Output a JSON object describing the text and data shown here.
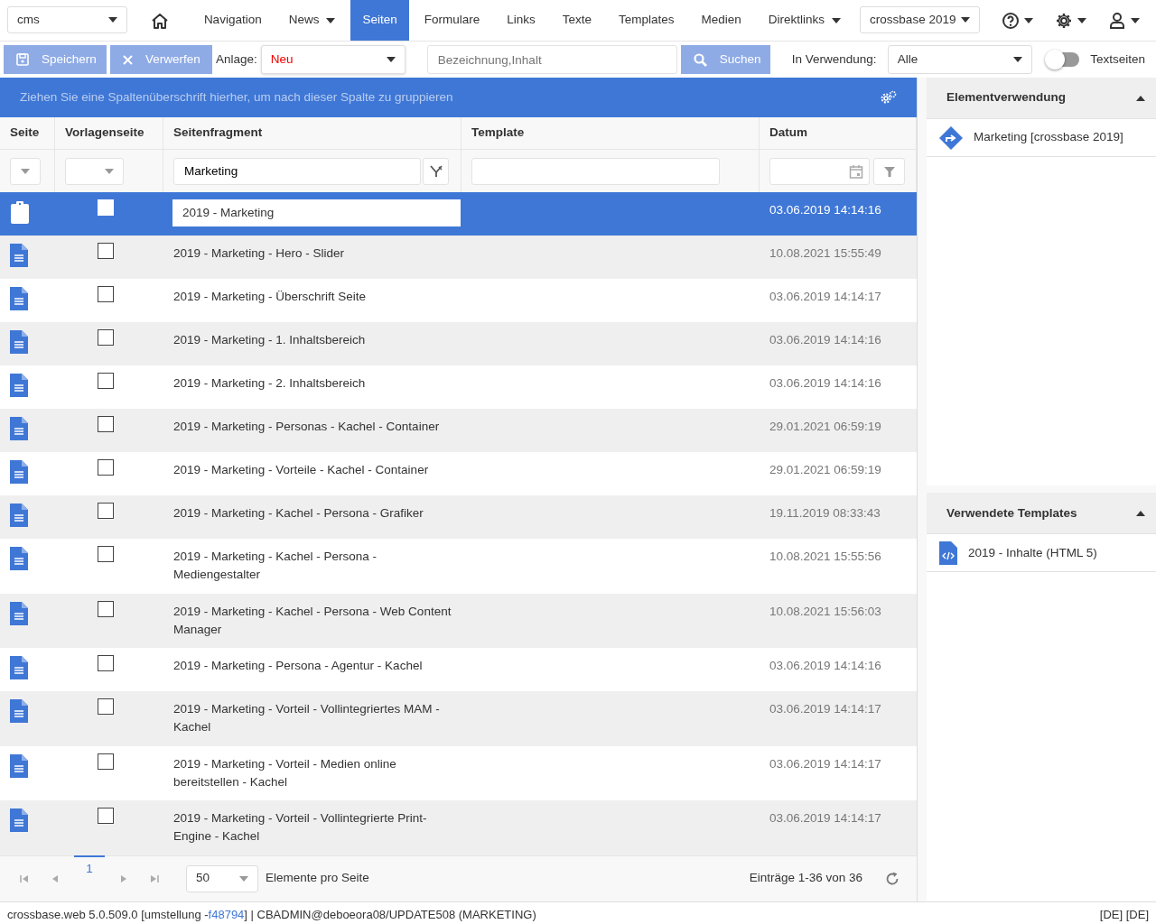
{
  "topnav": {
    "app_select": {
      "value": "cms"
    },
    "items": [
      {
        "label": "Navigation",
        "dropdown": false,
        "selected": false
      },
      {
        "label": "News",
        "dropdown": true,
        "selected": false
      },
      {
        "label": "Seiten",
        "dropdown": false,
        "selected": true
      },
      {
        "label": "Formulare",
        "dropdown": false,
        "selected": false
      },
      {
        "label": "Links",
        "dropdown": false,
        "selected": false
      },
      {
        "label": "Texte",
        "dropdown": false,
        "selected": false
      },
      {
        "label": "Templates",
        "dropdown": false,
        "selected": false
      },
      {
        "label": "Medien",
        "dropdown": false,
        "selected": false
      },
      {
        "label": "Direktlinks",
        "dropdown": true,
        "selected": false
      }
    ],
    "project_select": {
      "value": "crossbase 2019"
    }
  },
  "toolbar": {
    "save_button": "Speichern",
    "discard_button": "Verwerfen",
    "anlage_label": "Anlage:",
    "anlage_select": {
      "value": "Neu"
    },
    "search": {
      "placeholder": "Bezeichnung,Inhalt"
    },
    "search_button": "Suchen",
    "usage_label": "In Verwendung:",
    "usage_select": {
      "value": "Alle"
    },
    "textpages_toggle": {
      "label": "Textseiten",
      "on": false
    }
  },
  "grid": {
    "group_hint": "Ziehen Sie eine Spaltenüberschrift hierher, um nach dieser Spalte zu gruppieren",
    "columns": [
      "Seite",
      "Vorlagenseite",
      "Seitenfragment",
      "Template",
      "Datum"
    ],
    "filters": {
      "seitenfragment": "Marketing"
    },
    "rows": [
      {
        "kind": "clipboard",
        "checked": false,
        "fragment": "2019 - Marketing",
        "date": "03.06.2019 14:14:16",
        "selected": true
      },
      {
        "kind": "document",
        "checked": false,
        "fragment": "2019 - Marketing - Hero - Slider",
        "date": "10.08.2021 15:55:49",
        "selected": false
      },
      {
        "kind": "document",
        "checked": false,
        "fragment": "2019 - Marketing - Überschrift Seite",
        "date": "03.06.2019 14:14:17",
        "selected": false
      },
      {
        "kind": "document",
        "checked": false,
        "fragment": "2019 - Marketing - 1. Inhaltsbereich",
        "date": "03.06.2019 14:14:16",
        "selected": false
      },
      {
        "kind": "document",
        "checked": false,
        "fragment": "2019 - Marketing - 2. Inhaltsbereich",
        "date": "03.06.2019 14:14:16",
        "selected": false
      },
      {
        "kind": "document",
        "checked": false,
        "fragment": "2019 - Marketing - Personas - Kachel - Container",
        "date": "29.01.2021 06:59:19",
        "selected": false
      },
      {
        "kind": "document",
        "checked": false,
        "fragment": "2019 - Marketing - Vorteile - Kachel - Container",
        "date": "29.01.2021 06:59:19",
        "selected": false
      },
      {
        "kind": "document",
        "checked": false,
        "fragment": "2019 - Marketing - Kachel - Persona - Grafiker",
        "date": "19.11.2019 08:33:43",
        "selected": false
      },
      {
        "kind": "document",
        "checked": false,
        "fragment": "2019 - Marketing - Kachel - Persona - Mediengestalter",
        "date": "10.08.2021 15:55:56",
        "selected": false
      },
      {
        "kind": "document",
        "checked": false,
        "fragment": "2019 - Marketing - Kachel - Persona - Web Content Manager",
        "date": "10.08.2021 15:56:03",
        "selected": false
      },
      {
        "kind": "document",
        "checked": false,
        "fragment": "2019 - Marketing - Persona - Agentur - Kachel",
        "date": "03.06.2019 14:14:16",
        "selected": false
      },
      {
        "kind": "document",
        "checked": false,
        "fragment": "2019 - Marketing - Vorteil - Vollintegriertes MAM - Kachel",
        "date": "03.06.2019 14:14:17",
        "selected": false
      },
      {
        "kind": "document",
        "checked": false,
        "fragment": "2019 - Marketing - Vorteil - Medien online bereitstellen - Kachel",
        "date": "03.06.2019 14:14:17",
        "selected": false
      },
      {
        "kind": "document",
        "checked": false,
        "fragment": "2019 - Marketing - Vorteil - Vollintegrierte Print-Engine - Kachel",
        "date": "03.06.2019 14:14:17",
        "selected": false
      }
    ],
    "pager": {
      "pages": [
        {
          "label": "1",
          "selected": true
        }
      ],
      "page_size": "50",
      "page_size_label": "Elemente pro Seite",
      "summary": "Einträge 1-36 von 36"
    }
  },
  "side_panel": {
    "sections": [
      {
        "title": "Elementverwendung",
        "expanded": true,
        "items": [
          {
            "kind": "usage",
            "label": "Marketing [crossbase 2019]"
          }
        ]
      },
      {
        "title": "Verwendete Templates",
        "expanded": true,
        "items": [
          {
            "kind": "template",
            "label": "2019 - Inhalte (HTML 5)"
          }
        ]
      }
    ]
  },
  "status_bar": {
    "prefix": "crossbase.web 5.0.509.0 [umstellung  -",
    "link": "f48794",
    "suffix": "] | CBADMIN@deboeora08/UPDATE508 (MARKETING)",
    "language": "[DE] [DE]"
  }
}
